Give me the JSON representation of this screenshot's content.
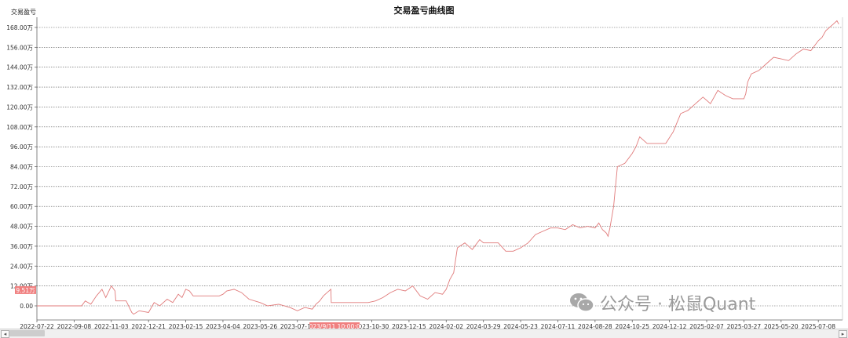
{
  "window": {
    "title": "交易盈亏曲线图"
  },
  "watermark": {
    "text": "公众号 · 松鼠Quant",
    "icon": "wechat-icon"
  },
  "colors": {
    "line": "#e07a7a",
    "grid": "#555555",
    "badge_bg": "#f08080"
  },
  "cursor": {
    "y_label": "9.51万",
    "x_label": "2023/9/11 10:00:00",
    "y_value": 9.51
  },
  "chart_data": {
    "type": "line",
    "title": "交易盈亏曲线图",
    "ylabel": "交易盈亏",
    "xlabel": "",
    "ylim": [
      -10,
      172
    ],
    "grid": "horizontal dotted",
    "y_ticks": [
      0,
      12,
      24,
      36,
      48,
      60,
      72,
      84,
      96,
      108,
      120,
      132,
      144,
      156,
      168
    ],
    "y_tick_labels": [
      "0.00",
      "12.00万",
      "24.00万",
      "36.00万",
      "48.00万",
      "60.00万",
      "72.00万",
      "84.00万",
      "96.00万",
      "108.00万",
      "120.00万",
      "132.00万",
      "144.00万",
      "156.00万",
      "168.00万"
    ],
    "x_tick_labels": [
      "2022-07-22",
      "2022-09-08",
      "2022-11-03",
      "2022-12-21",
      "2023-02-15",
      "2023-04-04",
      "2023-05-26",
      "2023-07-17",
      "2023-10-30",
      "2023-12-15",
      "2024-02-02",
      "2024-03-29",
      "2024-05-23",
      "2024-07-11",
      "2024-08-28",
      "2024-10-25",
      "2024-12-12",
      "2025-02-07",
      "2025-03-27",
      "2025-05-20",
      "2025-07-08"
    ],
    "x_tick_positions": [
      0,
      1,
      2,
      3,
      4,
      5,
      6,
      7,
      9,
      10,
      11,
      12,
      13,
      14,
      15,
      16,
      17,
      18,
      19,
      20,
      21
    ],
    "x_range": [
      0,
      21.65
    ],
    "series": [
      {
        "x": [
          0,
          1.2,
          1.3,
          1.45,
          1.6,
          1.75,
          1.85,
          2.0,
          2.1,
          2.12,
          2.4,
          2.55,
          2.6,
          2.75,
          3.0,
          3.15,
          3.3,
          3.5,
          3.65,
          3.8,
          3.9,
          4.0,
          4.1,
          4.2,
          4.5,
          4.7,
          4.9,
          5.0,
          5.1,
          5.3,
          5.5,
          5.7,
          6.0,
          6.2,
          6.5,
          6.8,
          7.0,
          7.2,
          7.4,
          7.5,
          7.6,
          7.7,
          7.8,
          7.9,
          7.91,
          8.5,
          8.9,
          9.1,
          9.3,
          9.5,
          9.7,
          9.9,
          10.1,
          10.3,
          10.5,
          10.7,
          10.9,
          11.0,
          11.1,
          11.2,
          11.3,
          11.5,
          11.7,
          11.9,
          12.0,
          12.1,
          12.2,
          12.4,
          12.6,
          12.8,
          13.0,
          13.2,
          13.4,
          13.6,
          13.8,
          14.0,
          14.2,
          14.4,
          14.6,
          14.8,
          15.0,
          15.1,
          15.2,
          15.25,
          15.3,
          15.35,
          15.4,
          15.5,
          15.6,
          15.8,
          16.0,
          16.1,
          16.2,
          16.4,
          16.6,
          16.8,
          16.9,
          17.1,
          17.3,
          17.5,
          17.7,
          17.9,
          18.1,
          18.3,
          18.5,
          18.7,
          18.9,
          19.0,
          19.05,
          19.1,
          19.2,
          19.4,
          19.6,
          19.8,
          20.0,
          20.2,
          20.4,
          20.6,
          20.8,
          21.0,
          21.1,
          21.2,
          21.3,
          21.4,
          21.5,
          21.55
        ],
        "y": [
          0,
          0,
          3,
          1,
          6,
          10,
          5,
          12,
          9,
          3,
          3,
          -4,
          -5,
          -3,
          -4,
          2,
          0,
          4,
          2,
          7,
          5,
          10,
          9,
          6,
          6,
          6,
          6,
          7,
          9,
          10,
          8,
          4,
          2,
          0,
          1,
          -1,
          -3,
          -1,
          -2,
          1,
          3,
          6,
          8,
          10,
          2,
          2,
          2,
          3,
          5,
          8,
          10,
          9,
          12,
          6,
          4,
          8,
          7,
          10,
          16,
          20,
          35,
          38,
          34,
          40,
          38,
          38,
          38,
          38,
          33,
          33,
          35,
          38,
          43,
          45,
          47,
          47,
          46,
          49,
          47,
          48,
          47,
          50,
          46,
          45,
          44,
          42,
          47,
          60,
          84,
          86,
          92,
          96,
          102,
          98,
          98,
          98,
          98,
          105,
          116,
          118,
          122,
          126,
          122,
          130,
          127,
          125,
          125,
          125,
          128,
          135,
          140,
          142,
          146,
          150,
          149,
          148,
          152,
          155,
          154,
          160,
          162,
          166,
          168,
          170,
          172,
          170
        ]
      }
    ]
  }
}
